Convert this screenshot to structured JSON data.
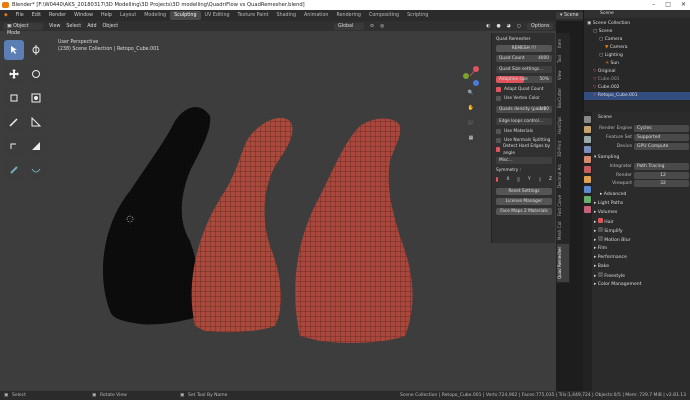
{
  "title": "Blender* [F:\\W0440\\AKS_20180317\\3D Modelling\\3D Projects\\3D modelling\\QuadriFlow vs QuadRemesher.blend]",
  "menu": [
    "File",
    "Edit",
    "Render",
    "Window",
    "Help"
  ],
  "workspaces": [
    "Layout",
    "Modeling",
    "Sculpting",
    "UV Editing",
    "Texture Paint",
    "Shading",
    "Animation",
    "Rendering",
    "Compositing",
    "Scripting"
  ],
  "active_workspace": "Sculpting",
  "scene_field": "Scene",
  "view_layer_field": "View Layer",
  "viewport": {
    "mode": "Object Mode",
    "menus": [
      "View",
      "Select",
      "Add",
      "Object"
    ],
    "orientation": "Global",
    "options": "Options",
    "info_line1": "User Perspective",
    "info_line2": "(238) Scene Collection | Retopo_Cube.001"
  },
  "npanel": {
    "title": "Quad Remesher",
    "remesh_button": "REMESH !!!",
    "quad_count_label": "Quad Count",
    "quad_count_value": "4000",
    "quad_size_settings": "Quad Size settings...",
    "adaptive_size_label": "Adaptive size",
    "adaptive_size_value": "50%",
    "adapt_quad_count": "Adapt Quad Count",
    "use_vertex_color": "Use Vertex Color",
    "quads_density_label": "Quads density (paint)",
    "quads_density_value": "1.00",
    "edge_loops_control": "Edge loops control...",
    "use_materials": "Use Materials",
    "use_normals_splitting": "Use Normals Splitting",
    "detect_hard_edges": "Detect Hard Edges by angle",
    "misc": "Misc...",
    "symmetry": "Symmetry :",
    "sym_x": "X",
    "sym_y": "Y",
    "sym_z": "Z",
    "reset_settings": "Reset Settings",
    "license_manager": "License Manager",
    "face_maps": "Face Maps 2 Materials"
  },
  "vtabs": [
    "Item",
    "Tool",
    "View",
    "BoxCutter",
    "HardOps",
    "3D-Print",
    "Decimal Arc",
    "Fast Carve",
    "Mesh Cut",
    "Quad Remesher"
  ],
  "outliner": {
    "title": "Scene",
    "items": [
      {
        "label": "Scene Collection"
      },
      {
        "label": "Scene"
      },
      {
        "label": "Camera"
      },
      {
        "label": "Camera"
      },
      {
        "label": "Lighting"
      },
      {
        "label": "Sun"
      },
      {
        "label": "Original"
      },
      {
        "label": "Cube.001"
      },
      {
        "label": "Cube.002"
      },
      {
        "label": "Retopo_Cube.001"
      }
    ]
  },
  "properties": {
    "tab_title": "Scene",
    "render_engine_label": "Render Engine",
    "render_engine_value": "Cycles",
    "feature_set_label": "Feature Set",
    "feature_set_value": "Supported",
    "device_label": "Device",
    "device_value": "GPU Compute",
    "sampling": "Sampling",
    "integrator_label": "Integrator",
    "integrator_value": "Path Tracing",
    "render_label": "Render",
    "render_value": "12",
    "viewport_label": "Viewport",
    "viewport_value": "32",
    "advanced": "Advanced",
    "light_paths": "Light Paths",
    "volumes": "Volumes",
    "hair": "Hair",
    "simplify": "Simplify",
    "motion_blur": "Motion Blur",
    "film": "Film",
    "performance": "Performance",
    "bake": "Bake",
    "freestyle": "Freestyle",
    "color_management": "Color Management"
  },
  "statusbar": {
    "left1": "Select",
    "left2": "Rotate View",
    "left3": "Set Tool By Name",
    "right": "Scene Collection | Retopo_Cube.001 | Verts:724,902 | Faces:775,035 | Tris:1,449,724 | Objects:0/5 | Mem: 729.7 MiB | v2.81.13"
  },
  "colors": {
    "accent": "#e0555d",
    "selection": "#334d80",
    "mesh_red": "#a9473d",
    "mesh_black": "#101010"
  }
}
